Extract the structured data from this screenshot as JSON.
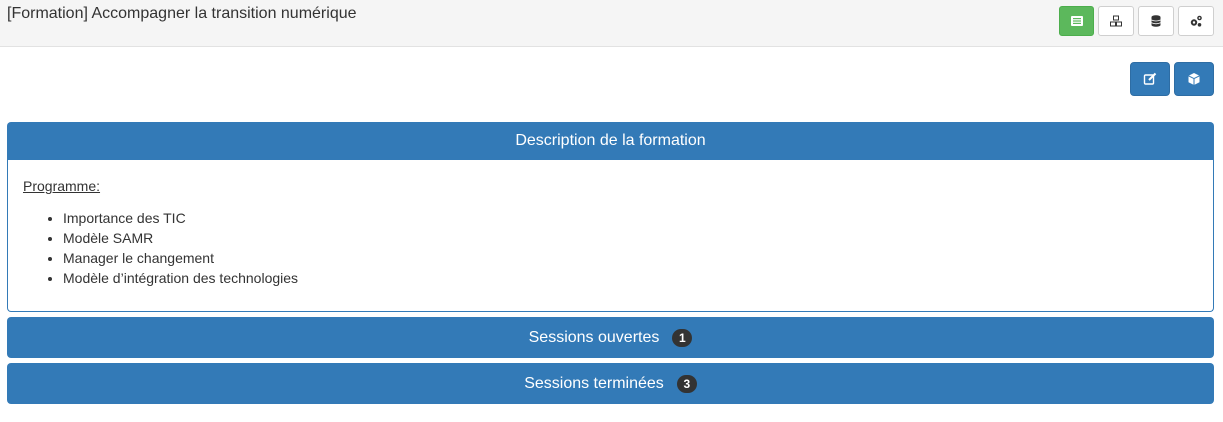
{
  "header": {
    "title": "[Formation] Accompagner la transition numérique",
    "buttons": [
      {
        "icon": "list-icon",
        "active": true
      },
      {
        "icon": "cubes-icon",
        "active": false
      },
      {
        "icon": "database-icon",
        "active": false
      },
      {
        "icon": "cogs-icon",
        "active": false
      }
    ]
  },
  "actions": [
    {
      "icon": "edit-icon"
    },
    {
      "icon": "cube-icon"
    }
  ],
  "description_panel": {
    "title": "Description de la formation",
    "programme_label": "Programme:",
    "topics": [
      "Importance des TIC",
      "Modèle SAMR",
      "Manager le changement",
      "Modèle d’intégration des technologies"
    ]
  },
  "sessions": [
    {
      "label": "Sessions ouvertes",
      "count": "1"
    },
    {
      "label": "Sessions terminées",
      "count": "3"
    }
  ],
  "colors": {
    "primary": "#337ab7",
    "success": "#5cb85c",
    "badge": "#333333",
    "topbar": "#f5f5f5"
  }
}
